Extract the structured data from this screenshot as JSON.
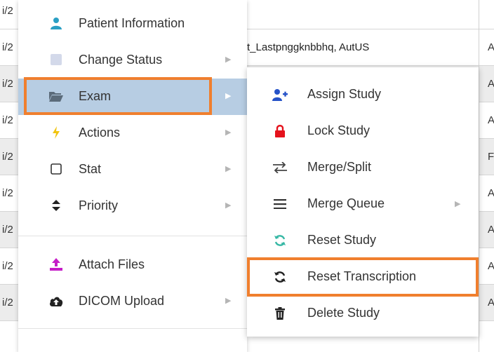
{
  "background_table": {
    "rows": [
      {
        "left": "i/2",
        "name": "",
        "right": ""
      },
      {
        "left": "i/2",
        "name": "t_Lastpnggknbbhq, AutUS",
        "right": "A"
      },
      {
        "left": "i/2",
        "name": "",
        "right": "A"
      },
      {
        "left": "i/2",
        "name": "",
        "right": "A"
      },
      {
        "left": "i/2",
        "name": "",
        "right": "F"
      },
      {
        "left": "i/2",
        "name": "",
        "right": "A"
      },
      {
        "left": "i/2",
        "name": "",
        "right": "A"
      },
      {
        "left": "i/2",
        "name": "",
        "right": "A"
      },
      {
        "left": "",
        "name": "",
        "right": ""
      }
    ]
  },
  "context_menu": {
    "items": [
      {
        "label": "Patient Information",
        "icon": "user-icon",
        "has_submenu": false
      },
      {
        "label": "Change Status",
        "icon": "square-icon",
        "has_submenu": true
      },
      {
        "label": "Exam",
        "icon": "folder-open-icon",
        "has_submenu": true,
        "active": true
      },
      {
        "label": "Actions",
        "icon": "bolt-icon",
        "has_submenu": true
      },
      {
        "label": "Stat",
        "icon": "checkbox-icon",
        "has_submenu": true
      },
      {
        "label": "Priority",
        "icon": "sort-icon",
        "has_submenu": true
      },
      {
        "label": "Attach Files",
        "icon": "upload-icon",
        "has_submenu": false
      },
      {
        "label": "DICOM Upload",
        "icon": "cloud-upload-icon",
        "has_submenu": true
      }
    ]
  },
  "exam_submenu": {
    "items": [
      {
        "label": "Assign Study",
        "icon": "user-plus-icon",
        "has_submenu": false
      },
      {
        "label": "Lock Study",
        "icon": "lock-icon",
        "has_submenu": false
      },
      {
        "label": "Merge/Split",
        "icon": "exchange-icon",
        "has_submenu": false
      },
      {
        "label": "Merge Queue",
        "icon": "bars-icon",
        "has_submenu": true
      },
      {
        "label": "Reset Study",
        "icon": "refresh-icon",
        "has_submenu": false
      },
      {
        "label": "Reset Transcription",
        "icon": "sync-icon",
        "has_submenu": false,
        "highlighted": true
      },
      {
        "label": "Delete Study",
        "icon": "trash-icon",
        "has_submenu": false
      }
    ]
  },
  "colors": {
    "highlight_orange": "#f07f2e",
    "active_row_bg": "#b7cde3",
    "user_icon": "#2a9fc4",
    "square_icon": "#d3d9ea",
    "folder_icon": "#5b6b7a",
    "bolt_icon": "#f1c40f",
    "upload_icon": "#c51dc7",
    "assign_icon": "#2552c8",
    "lock_icon": "#e5121c",
    "reset_study_icon": "#37b8a5"
  }
}
